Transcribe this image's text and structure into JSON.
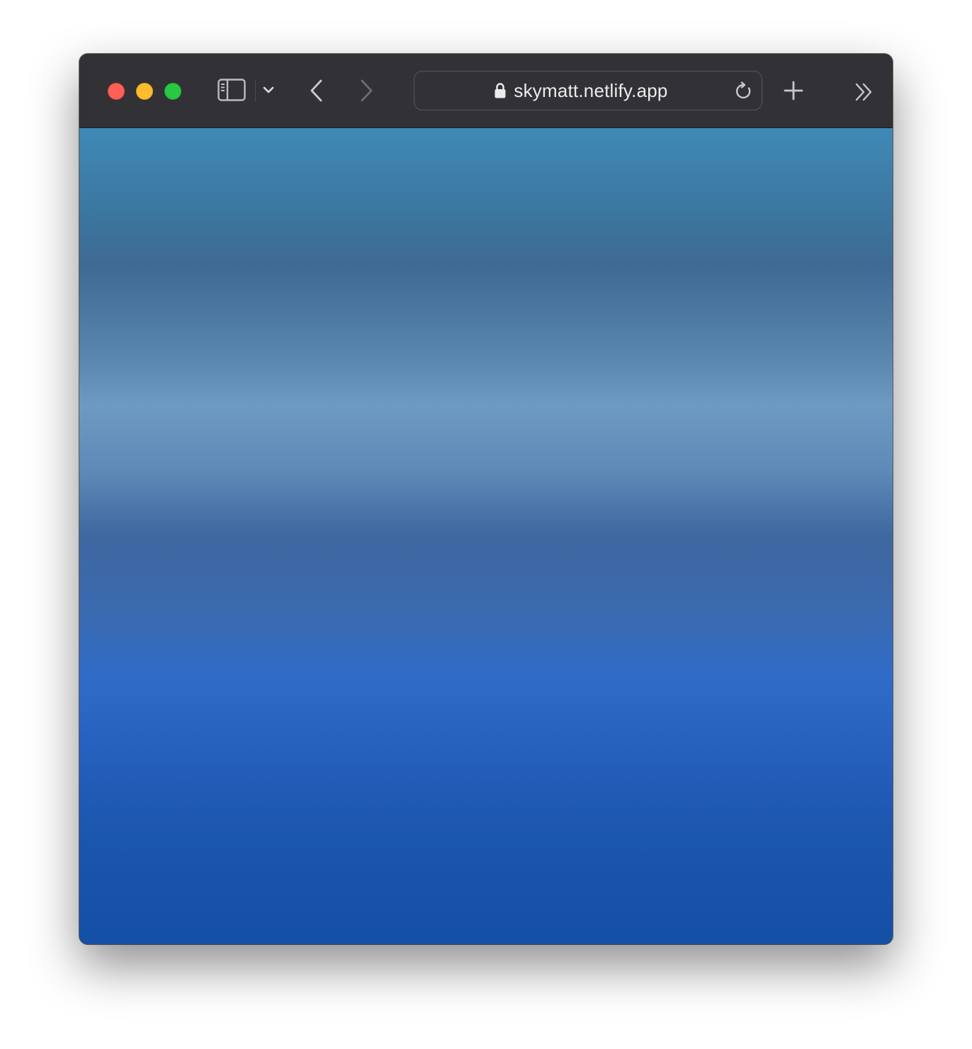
{
  "browser": {
    "address_bar": {
      "url": "skymatt.netlify.app",
      "secure": true
    },
    "icons": {
      "close": "close-window-icon",
      "minimize": "minimize-window-icon",
      "maximize": "maximize-window-icon",
      "sidebar": "sidebar-icon",
      "tab_group_menu": "chevron-down-icon",
      "back": "chevron-left-icon",
      "forward": "chevron-right-icon",
      "lock": "lock-icon",
      "reload": "reload-icon",
      "new_tab": "plus-icon",
      "overflow": "double-chevron-right-icon"
    },
    "colors": {
      "toolbar": "#323135",
      "traffic_close": "#fe5f57",
      "traffic_minimize": "#febc2e",
      "traffic_maximize": "#28c840",
      "sky_top": "#3f89b6",
      "sky_middle": "#6d9ac1",
      "sky_bottom": "#1450a6"
    }
  }
}
